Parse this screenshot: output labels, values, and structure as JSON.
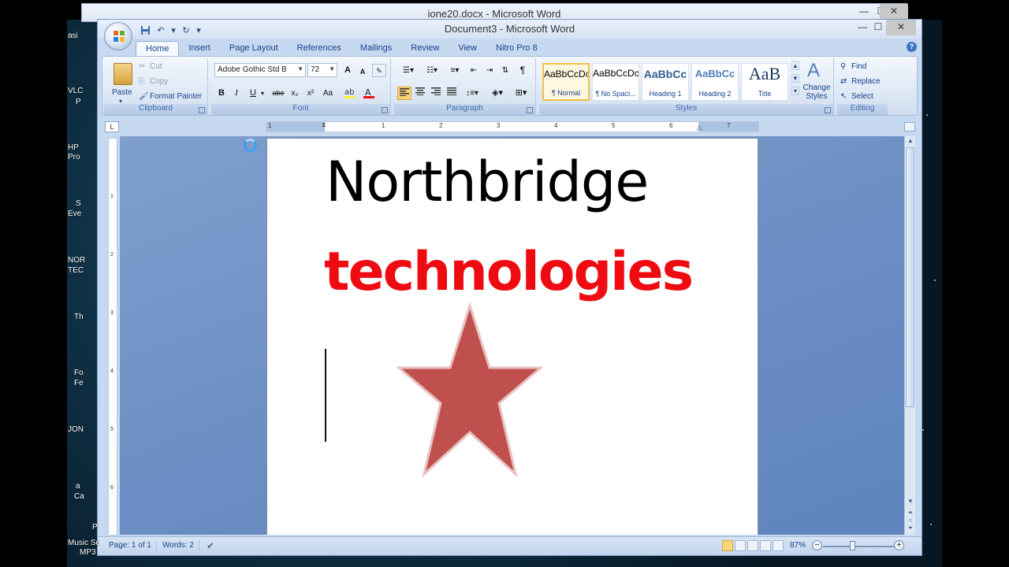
{
  "back_window": {
    "title": "ione20.docx - Microsoft Word"
  },
  "window": {
    "title": "Document3 - Microsoft Word",
    "min": "—",
    "max": "☐",
    "close": "✕"
  },
  "desktop_labels": [
    "asi",
    "VLC",
    "P",
    "HP",
    "Pro",
    "S",
    "Eve",
    "NOR",
    "TEC",
    "Th",
    "Fo",
    "Fe",
    "JON",
    "a",
    "Ca",
    "P",
    "Music Se",
    "MP3"
  ],
  "tabs": [
    "Home",
    "Insert",
    "Page Layout",
    "References",
    "Mailings",
    "Review",
    "View",
    "Nitro Pro 8"
  ],
  "help": "?",
  "clipboard": {
    "label": "Clipboard",
    "paste": "Paste",
    "cut": "Cut",
    "copy": "Copy",
    "format_painter": "Format Painter"
  },
  "font": {
    "label": "Font",
    "name": "Adobe Gothic Std B",
    "size": "72",
    "bold": "B",
    "italic": "I",
    "underline": "U",
    "strike": "abe",
    "sub": "x₂",
    "sup": "x²",
    "change_case": "Aa",
    "grow": "A",
    "shrink": "A"
  },
  "paragraph": {
    "label": "Paragraph",
    "pilcrow": "¶"
  },
  "styles": {
    "label": "Styles",
    "change_styles": "Change Styles",
    "items": [
      {
        "sample": "AaBbCcDc",
        "name": "¶ Normal"
      },
      {
        "sample": "AaBbCcDc",
        "name": "¶ No Spaci..."
      },
      {
        "sample": "AaBbCc",
        "name": "Heading 1"
      },
      {
        "sample": "AaBbCc",
        "name": "Heading 2"
      },
      {
        "sample": "AaB",
        "name": "Title"
      }
    ]
  },
  "editing": {
    "label": "Editing",
    "find": "Find",
    "replace": "Replace",
    "select": "Select"
  },
  "ruler": {
    "corner": "L",
    "numbers": [
      "1",
      "1",
      "2",
      "3",
      "4",
      "5",
      "6",
      "7"
    ],
    "v_numbers": [
      "1",
      "2",
      "3",
      "4",
      "5",
      "6"
    ]
  },
  "document": {
    "heading": "Northbridge",
    "subheading": "technologies",
    "subheading_color": "#ee0c12",
    "star_color": "#c0504d"
  },
  "status": {
    "page": "Page: 1 of 1",
    "words": "Words: 2",
    "zoom": "87%",
    "zoom_out": "−",
    "zoom_in": "+"
  }
}
